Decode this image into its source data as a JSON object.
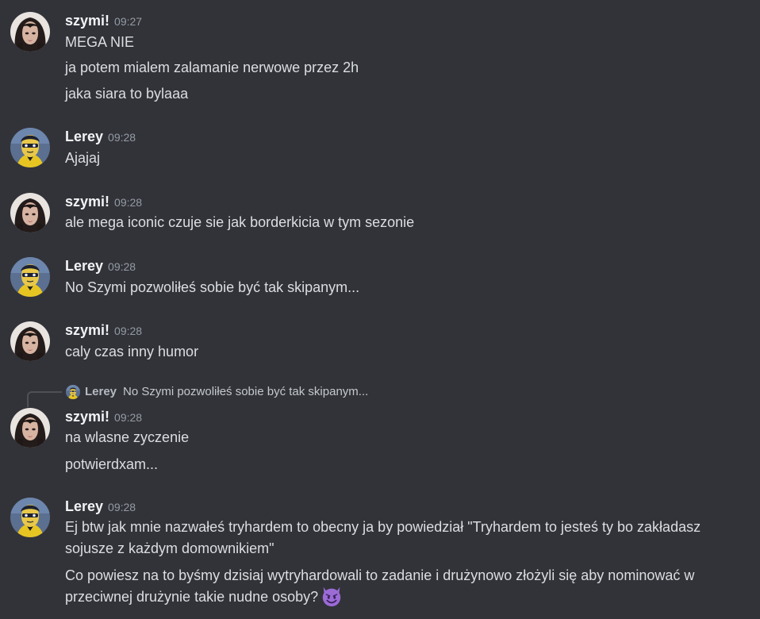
{
  "messages": [
    {
      "author": "szymi!",
      "time": "09:27",
      "avatar": "szymi-avatar",
      "lines": [
        "MEGA NIE",
        "ja potem mialem zalamanie nerwowe przez 2h",
        "jaka siara to bylaaa"
      ]
    },
    {
      "author": "Lerey",
      "time": "09:28",
      "avatar": "lerey-avatar",
      "lines": [
        "Ajajaj"
      ]
    },
    {
      "author": "szymi!",
      "time": "09:28",
      "avatar": "szymi-avatar",
      "lines": [
        "ale mega iconic czuje sie jak borderkicia w tym sezonie"
      ]
    },
    {
      "author": "Lerey",
      "time": "09:28",
      "avatar": "lerey-avatar",
      "lines": [
        "No Szymi pozwoliłeś sobie być tak skipanym..."
      ]
    },
    {
      "author": "szymi!",
      "time": "09:28",
      "avatar": "szymi-avatar",
      "lines": [
        "caly czas inny humor"
      ]
    },
    {
      "author": "szymi!",
      "time": "09:28",
      "avatar": "szymi-avatar",
      "reply": {
        "author": "Lerey",
        "text": "No Szymi pozwoliłeś sobie być tak skipanym..."
      },
      "lines": [
        "na wlasne zyczenie",
        "potwierdxam..."
      ]
    },
    {
      "author": "Lerey",
      "time": "09:28",
      "avatar": "lerey-avatar",
      "lines": [
        "Ej btw jak mnie nazwałeś tryhardem to obecny ja by powiedział \"Tryhardem to jesteś ty bo zakładasz sojusze z każdym domownikiem\"",
        "Co powiesz na to byśmy dzisiaj wytryhardowali to zadanie i drużynowo złożyli się aby nominować w przeciwnej drużynie takie nudne osoby?"
      ],
      "emoji": "smiling-imp-emoji"
    }
  ],
  "colors": {
    "background": "#323339",
    "username": "#f2f3f5",
    "text": "#dbdee1",
    "timestamp": "#949ba4"
  }
}
